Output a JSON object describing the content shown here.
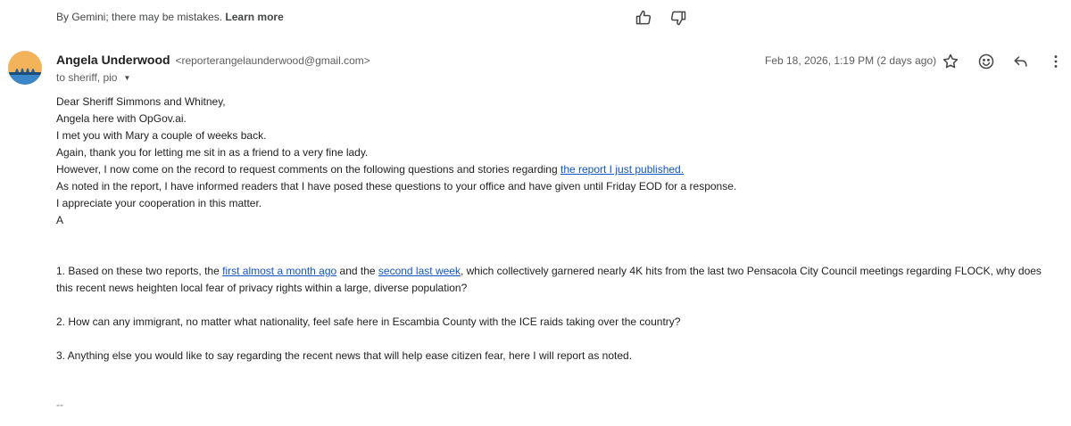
{
  "disclaimer": {
    "text": "By Gemini; there may be mistakes.",
    "link": "Learn more"
  },
  "sender": {
    "name": "Angela Underwood",
    "email": "<reporterangelaunderwood@gmail.com>"
  },
  "recipients": "to sheriff, pio",
  "date": "Feb 18, 2026, 1:19 PM (2 days ago)",
  "icons": {
    "thumbs_up": "thumbs-up-icon",
    "thumbs_down": "thumbs-down-icon",
    "star": "star-icon",
    "emoji": "emoji-icon",
    "reply": "reply-icon",
    "more": "more-vert-icon"
  },
  "colors": {
    "link": "#1155cc",
    "avatar_bg": "#f2b35a",
    "avatar_water": "#3a86c8"
  },
  "body": {
    "line1": "Dear Sheriff Simmons and Whitney,",
    "line2": "Angela here with OpGov.ai.",
    "line3": "I met you with Mary a couple of weeks back.",
    "line4": "Again, thank you for letting me sit in as a friend to a very fine lady.",
    "line5_pre": "However, I now come on the record to request comments on the following questions and stories regarding ",
    "line5_link": "the report I just published.",
    "line6": "As noted in the report, I have informed readers that I have posed these questions to your office and have given until Friday EOD for a response.",
    "line7": "I appreciate your cooperation in this matter.",
    "line8": "A",
    "q1_pre": "1. Based on these two reports, the ",
    "q1_link1": "first almost a month ago",
    "q1_mid": " and the ",
    "q1_link2": "second last week",
    "q1_post": ", which collectively garnered nearly 4K hits from the last two Pensacola City Council meetings regarding FLOCK, why does this recent news heighten local fear of privacy rights within a large, diverse population?",
    "q2": "2. How can any immigrant, no matter what nationality, feel safe here in Escambia County with the ICE raids taking over the country?",
    "q3": "3. Anything else you would like to say regarding the recent news that will help ease citizen fear, here I will report as noted."
  },
  "signature": "--"
}
